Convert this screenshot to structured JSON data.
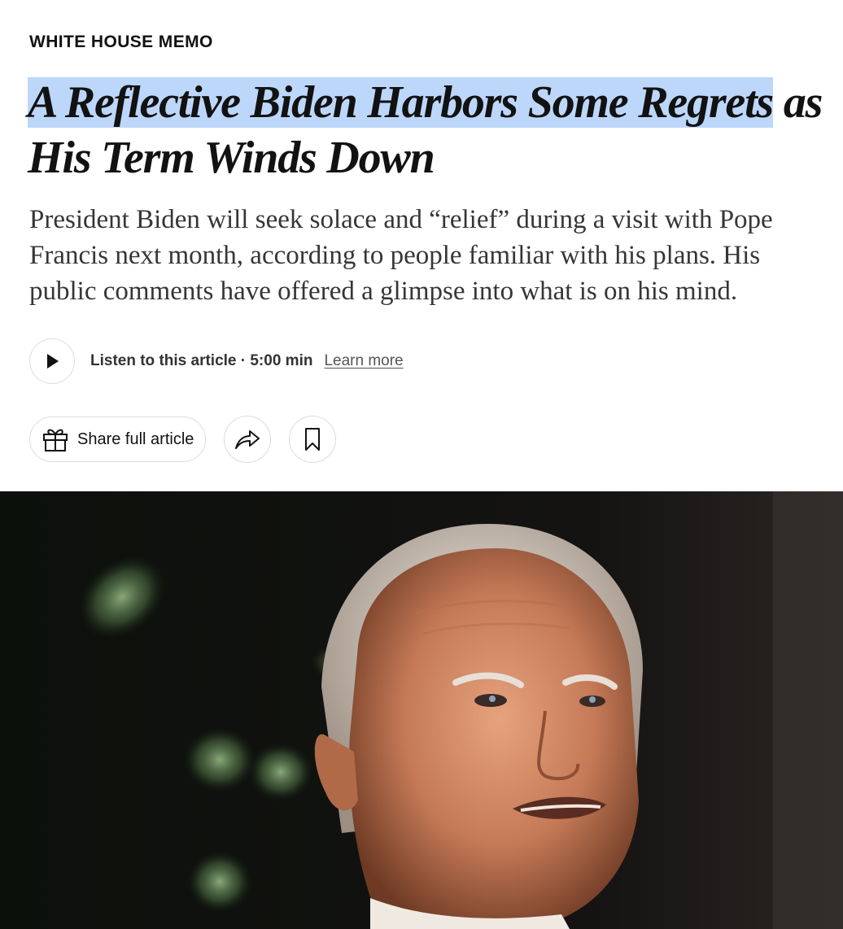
{
  "article": {
    "kicker": "WHITE HOUSE MEMO",
    "headline_highlighted": "A Reflective Biden Harbors Some Regrets",
    "headline_rest": " as His Term Winds Down",
    "summary": "President Biden will seek solace and “relief” during a visit with Pope Francis next month, according to people familiar with his plans. His public comments have offered a glimpse into what is on his mind."
  },
  "audio": {
    "listen_label": "Listen to this article · 5:00 min",
    "learn_more": "Learn more",
    "play_icon": "play-icon"
  },
  "actions": {
    "share_label": "Share full article",
    "gift_icon": "gift-icon",
    "forward_icon": "share-arrow-icon",
    "bookmark_icon": "bookmark-icon"
  },
  "colors": {
    "highlight": "#bdd7fb",
    "text": "#121212",
    "summary_text": "#363636",
    "border": "#dcdcdc"
  }
}
